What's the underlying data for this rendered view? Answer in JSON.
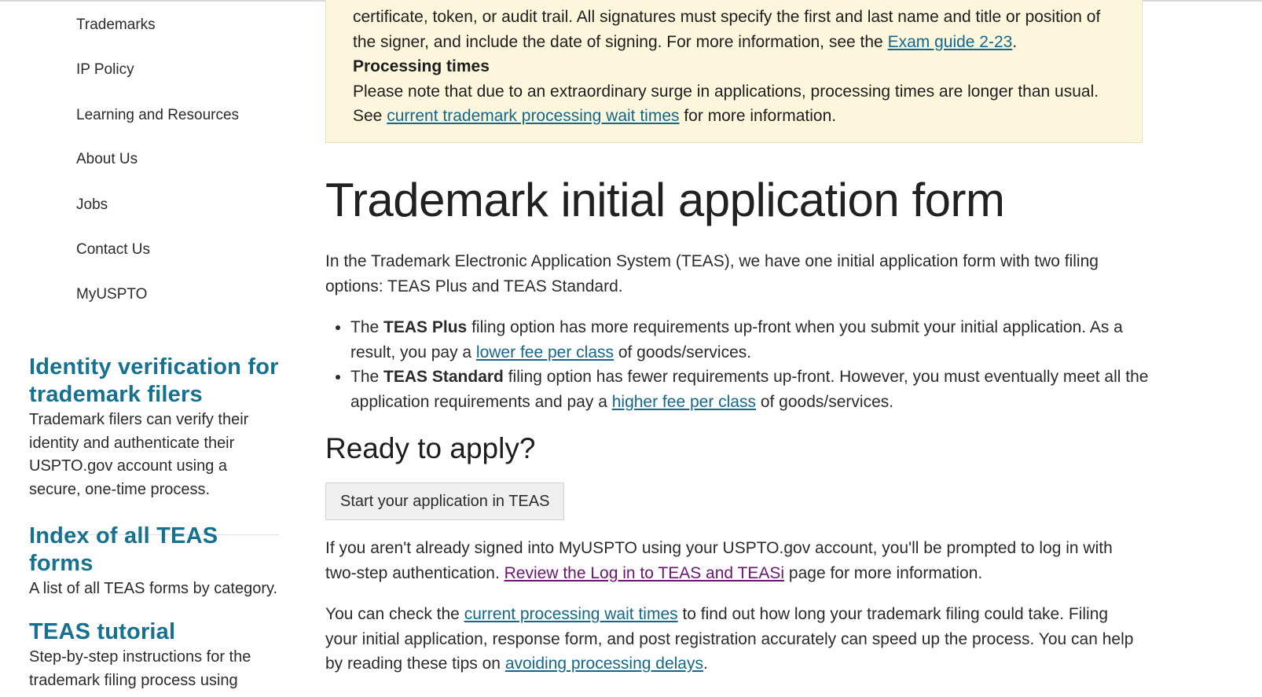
{
  "sidebar": {
    "nav_items": [
      {
        "label": "Trademarks"
      },
      {
        "label": "IP Policy"
      },
      {
        "label": "Learning and Resources"
      },
      {
        "label": "About Us"
      },
      {
        "label": "Jobs"
      },
      {
        "label": "Contact Us"
      },
      {
        "label": "MyUSPTO"
      }
    ],
    "promos": [
      {
        "title": "Identity verification for trademark filers",
        "description": "Trademark filers can verify their identity and authenticate their USPTO.gov account using a secure, one-time process."
      },
      {
        "title": "Index of all TEAS forms",
        "description": "A list of all TEAS forms by category."
      },
      {
        "title": "TEAS tutorial",
        "description": "Step-by-step instructions for the trademark filing process using"
      }
    ]
  },
  "alert": {
    "text_line1": "certificate, token, or audit trail. All signatures must specify the first and last name and title or position of the signer, and include the date of signing. For more information, see the ",
    "exam_guide_link": "Exam guide 2-23",
    "text_line1_end": ".",
    "heading": "Processing times",
    "text_line2": "Please note that due to an extraordinary surge in applications, processing times are longer than usual. See ",
    "wait_times_link": "current trademark processing wait times",
    "text_line2_end": " for more information."
  },
  "main": {
    "title": "Trademark initial application form",
    "intro": "In the Trademark Electronic Application System (TEAS), we have one initial application form with two filing options: TEAS Plus and TEAS Standard.",
    "options": [
      {
        "prefix": "The ",
        "bold": "TEAS Plus",
        "middle": " filing option has more requirements up-front when you submit your initial application. As a result, you pay a ",
        "link": "lower fee per class",
        "suffix": " of goods/services."
      },
      {
        "prefix": "The ",
        "bold": "TEAS Standard",
        "middle": " filing option has fewer requirements up-front. However, you must eventually meet all the application requirements and pay a ",
        "link": "higher fee per class",
        "suffix": " of goods/services."
      }
    ],
    "ready_heading": "Ready to apply?",
    "start_button": "Start your application in TEAS",
    "signin_text": "If you aren't already signed into MyUSPTO using your USPTO.gov account, you'll be prompted to log in with two-step authentication. ",
    "signin_link": "Review the Log in to TEAS and TEASi",
    "signin_end": " page for more information.",
    "wait_prefix": "You can check the ",
    "wait_link": "current processing wait times",
    "wait_middle": " to find out how long your trademark filing could take. Filing your initial application, response form, and post registration accurately can speed up the process. You can help by reading these tips on ",
    "delays_link": "avoiding processing delays",
    "wait_end": "."
  },
  "colors": {
    "link": "#15678a",
    "visited_link": "#6b1673",
    "promo_title": "#16708f",
    "alert_bg": "#fcf6dc"
  }
}
